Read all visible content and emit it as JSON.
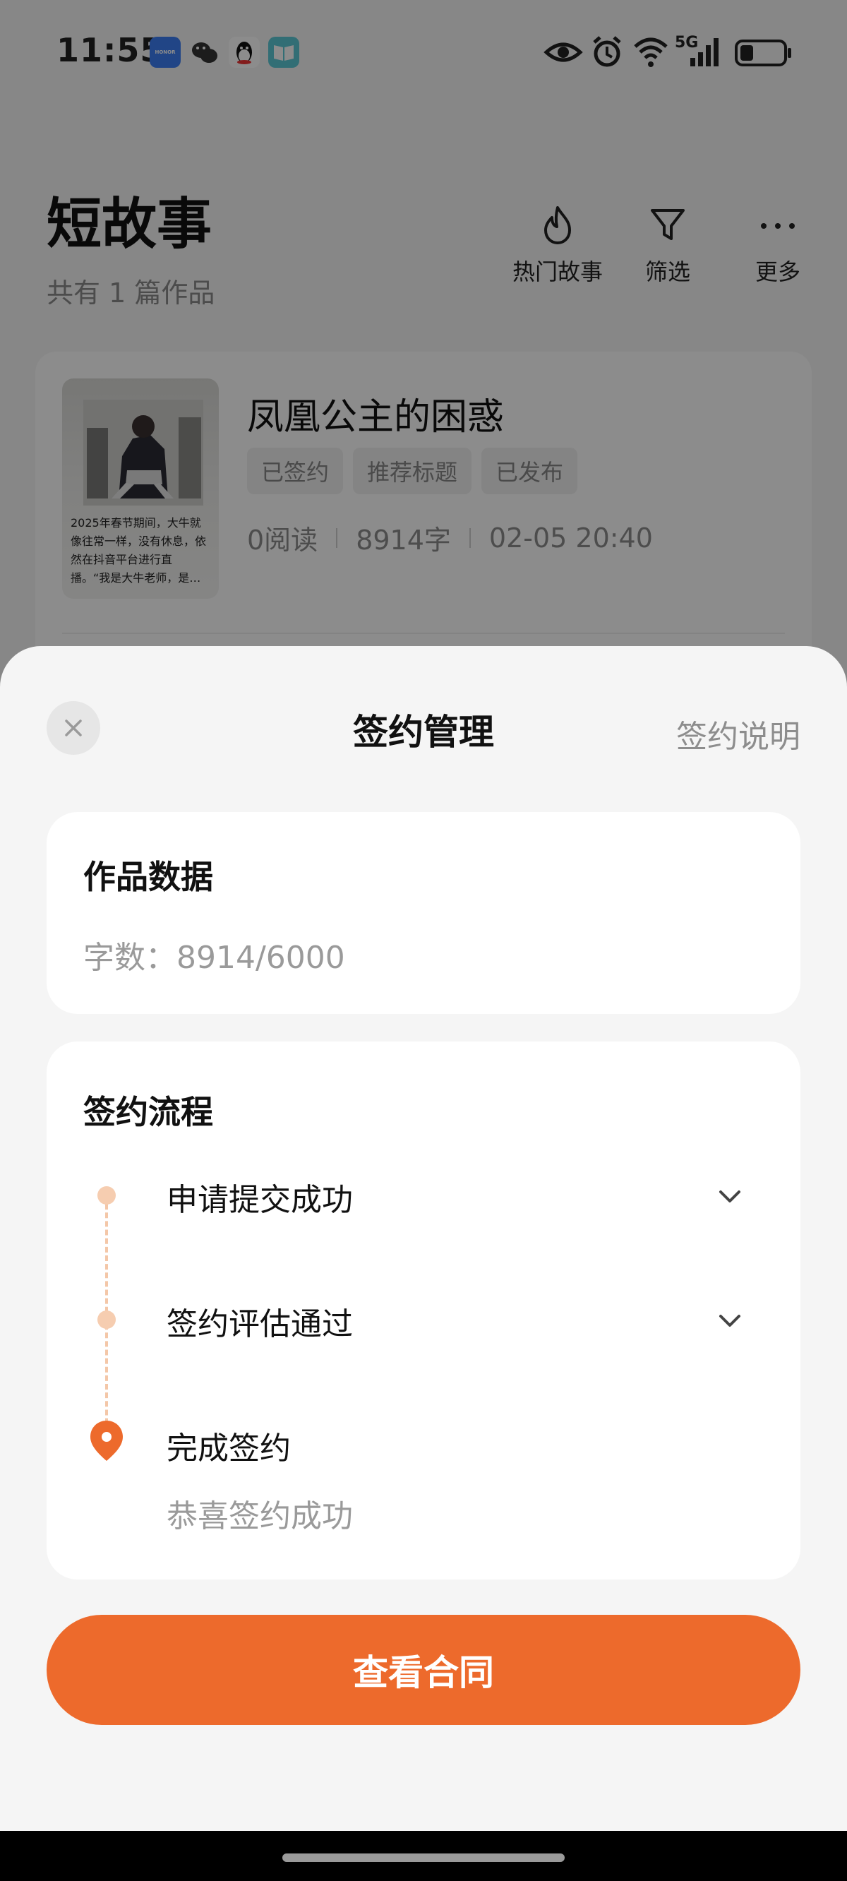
{
  "status_bar": {
    "time": "11:55",
    "app_icons": [
      "honor-app-icon",
      "wechat-icon",
      "qq-icon",
      "reader-app-icon"
    ],
    "honor_label": "HONOR",
    "network": "5G",
    "indicators": [
      "eye-comfort-icon",
      "alarm-icon",
      "wifi-icon",
      "signal-5g-icon",
      "battery-icon"
    ]
  },
  "header": {
    "title": "短故事",
    "subtitle": "共有 1 篇作品",
    "actions": [
      {
        "label": "热门故事",
        "icon": "flame-icon"
      },
      {
        "label": "筛选",
        "icon": "filter-icon"
      },
      {
        "label": "更多",
        "icon": "more-icon"
      }
    ]
  },
  "story": {
    "title": "凤凰公主的困惑",
    "cover_text": "2025年春节期间，大牛就像往常一样，没有休息，依然在抖音平台进行直播。“我是大牛老师，是…",
    "tags": [
      "已签约",
      "推荐标题",
      "已发布"
    ],
    "reads": "0阅读",
    "words": "8914字",
    "date": "02-05 20:40"
  },
  "sheet": {
    "title": "签约管理",
    "help_link": "签约说明",
    "data_section": {
      "heading": "作品数据",
      "word_count": "字数：8914/6000"
    },
    "process_section": {
      "heading": "签约流程",
      "steps": [
        {
          "label": "申请提交成功"
        },
        {
          "label": "签约评估通过"
        },
        {
          "label": "完成签约",
          "sub": "恭喜签约成功"
        }
      ]
    },
    "button_label": "查看合同"
  },
  "colors": {
    "accent": "#ED6A2C",
    "step_dot": "#F6CDB0",
    "scrim": "rgba(0,0,0,0.45)"
  }
}
